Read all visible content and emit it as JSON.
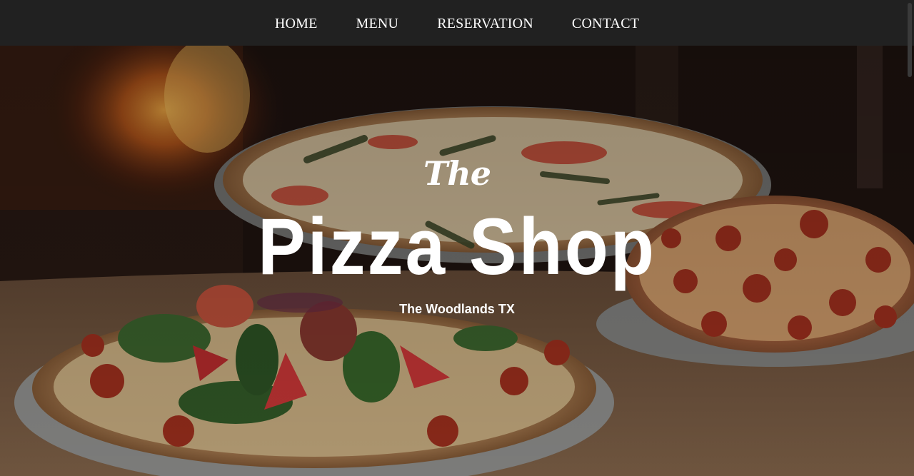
{
  "nav": {
    "items": [
      {
        "label": "HOME"
      },
      {
        "label": "MENU"
      },
      {
        "label": "RESERVATION"
      },
      {
        "label": "CONTACT"
      }
    ]
  },
  "hero": {
    "kicker": "The",
    "title": "Pizza Shop",
    "subtitle": "The Woodlands TX",
    "background": "photo of pizzas on metal trays in front of a wood-fired oven",
    "text_color": "#ffffff"
  },
  "colors": {
    "navbar": "#212121",
    "nav_text": "#ffffff"
  }
}
